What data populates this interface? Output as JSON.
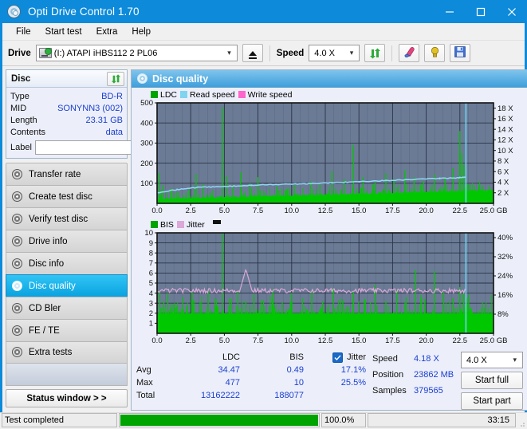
{
  "window": {
    "title": "Opti Drive Control 1.70",
    "icon": "disc-icon",
    "minimize": "minimize-icon",
    "maximize": "maximize-icon",
    "close": "close-icon",
    "accent": "#0d8ada"
  },
  "menu": {
    "items": [
      "File",
      "Start test",
      "Extra",
      "Help"
    ]
  },
  "toolbar": {
    "drive_label": "Drive",
    "drive_value": "(I:)  ATAPI iHBS112  2 PL06",
    "eject_icon": "eject-icon",
    "speed_label": "Speed",
    "speed_value": "4.0 X",
    "refresh_icon": "refresh-icon",
    "eraser_icon": "eraser-icon",
    "bulb_icon": "bulb-icon",
    "save_icon": "save-icon"
  },
  "disc": {
    "title": "Disc",
    "refresh_icon": "refresh-icon",
    "rows": [
      {
        "key": "Type",
        "value": "BD-R"
      },
      {
        "key": "MID",
        "value": "SONYNN3 (002)"
      },
      {
        "key": "Length",
        "value": "23.31 GB"
      },
      {
        "key": "Contents",
        "value": "data"
      }
    ],
    "label_key": "Label",
    "label_value": "",
    "label_placeholder": "",
    "cd_icon": "cd-icon"
  },
  "nav": {
    "items": [
      {
        "label": "Transfer rate",
        "active": false
      },
      {
        "label": "Create test disc",
        "active": false
      },
      {
        "label": "Verify test disc",
        "active": false
      },
      {
        "label": "Drive info",
        "active": false
      },
      {
        "label": "Disc info",
        "active": false
      },
      {
        "label": "Disc quality",
        "active": true
      },
      {
        "label": "CD Bler",
        "active": false
      },
      {
        "label": "FE / TE",
        "active": false
      },
      {
        "label": "Extra tests",
        "active": false
      }
    ],
    "status_button": "Status window > >"
  },
  "main": {
    "title": "Disc quality",
    "icon": "disc-quality-icon"
  },
  "chart_data": [
    {
      "type": "line",
      "name": "ldc-chart",
      "title": "",
      "xlabel": "",
      "ylabel": "",
      "legend": [
        {
          "label": "LDC",
          "color": "#00a400"
        },
        {
          "label": "Read speed",
          "color": "#7fd4f0"
        },
        {
          "label": "Write speed",
          "color": "#ff66cc"
        }
      ],
      "legend_position": "top-left",
      "grid": true,
      "plot_bg": "#6b7b96",
      "xlim": [
        0,
        25.0
      ],
      "xticks": [
        0.0,
        2.5,
        5.0,
        7.5,
        10.0,
        12.5,
        15.0,
        17.5,
        20.0,
        22.5,
        25.0
      ],
      "xticklabels": [
        "0.0",
        "2.5",
        "5.0",
        "7.5",
        "10.0",
        "12.5",
        "15.0",
        "17.5",
        "20.0",
        "22.5",
        "25.0 GB"
      ],
      "ylim": [
        0,
        500
      ],
      "yticks": [
        100,
        200,
        300,
        400,
        500
      ],
      "yticklabels": [
        "100",
        "200",
        "300",
        "400",
        "500"
      ],
      "y2lim": [
        0,
        19
      ],
      "y2ticks": [
        2,
        4,
        6,
        8,
        10,
        12,
        14,
        16,
        18
      ],
      "y2ticklabels": [
        "2 X",
        "4 X",
        "6 X",
        "8 X",
        "10 X",
        "12 X",
        "14 X",
        "16 X",
        "18 X"
      ],
      "series": [
        {
          "name": "LDC",
          "color": "#00c800",
          "style": "filled-spikes",
          "baseline": [
            18,
            20,
            22,
            19,
            24,
            21,
            26,
            23,
            20,
            25,
            22,
            27,
            24,
            21,
            26,
            23,
            28,
            25,
            22,
            27,
            24,
            29,
            26,
            23,
            28,
            25,
            30,
            27,
            24,
            29,
            26,
            31,
            28,
            25,
            30,
            27,
            32,
            29,
            26,
            31,
            28,
            33,
            30,
            27,
            32,
            29,
            34,
            31,
            28,
            33,
            30,
            35,
            32,
            29,
            34,
            31,
            36,
            33,
            30,
            35,
            32,
            37,
            34,
            31,
            36,
            33,
            38,
            35,
            32,
            37,
            34,
            39,
            36,
            33,
            38,
            35,
            40,
            37,
            34,
            39,
            36,
            41,
            38,
            35,
            40,
            37,
            42,
            39,
            36,
            41,
            38,
            43,
            40,
            37,
            42,
            39,
            44,
            41,
            38,
            43,
            40,
            45,
            42,
            39,
            44,
            41,
            46,
            43,
            40,
            45,
            42,
            47,
            44,
            41,
            46,
            43,
            48,
            45,
            42,
            47,
            44,
            49,
            46,
            43,
            48,
            45,
            50,
            47,
            44,
            49,
            46,
            51,
            48,
            45,
            50,
            47,
            52,
            49,
            46,
            51,
            48,
            53,
            50,
            47,
            52,
            49,
            54,
            51,
            48,
            53,
            50,
            55,
            52,
            49,
            54,
            51,
            56,
            53,
            50,
            55,
            52,
            57,
            54,
            51,
            56,
            53,
            58,
            55,
            52,
            57,
            54,
            59,
            56,
            53,
            58,
            55,
            60,
            57,
            54,
            59,
            56,
            61,
            58,
            55,
            60,
            57,
            62,
            59,
            56,
            61,
            58,
            63,
            60,
            57,
            62,
            59,
            64,
            61,
            58,
            63,
            62,
            66,
            63,
            60,
            65,
            62,
            67,
            64,
            61,
            66,
            63,
            68,
            65,
            62,
            67,
            64,
            69,
            66,
            63,
            68
          ],
          "spikes": [
            {
              "x": 0.15,
              "y": 150
            },
            {
              "x": 0.45,
              "y": 90
            },
            {
              "x": 1.1,
              "y": 75
            },
            {
              "x": 2.4,
              "y": 70
            },
            {
              "x": 2.9,
              "y": 145
            },
            {
              "x": 3.4,
              "y": 95
            },
            {
              "x": 4.85,
              "y": 477
            },
            {
              "x": 5.15,
              "y": 135
            },
            {
              "x": 5.6,
              "y": 90
            },
            {
              "x": 6.2,
              "y": 155
            },
            {
              "x": 6.9,
              "y": 100
            },
            {
              "x": 7.5,
              "y": 130
            },
            {
              "x": 8.9,
              "y": 85
            },
            {
              "x": 10.2,
              "y": 90
            },
            {
              "x": 11.4,
              "y": 110
            },
            {
              "x": 12.1,
              "y": 95
            },
            {
              "x": 13.0,
              "y": 160
            },
            {
              "x": 13.9,
              "y": 120
            },
            {
              "x": 14.6,
              "y": 290
            },
            {
              "x": 15.3,
              "y": 130
            },
            {
              "x": 16.2,
              "y": 105
            },
            {
              "x": 17.0,
              "y": 150
            },
            {
              "x": 17.6,
              "y": 120
            },
            {
              "x": 18.4,
              "y": 165
            },
            {
              "x": 19.1,
              "y": 130
            },
            {
              "x": 19.8,
              "y": 110
            },
            {
              "x": 20.6,
              "y": 145
            },
            {
              "x": 21.4,
              "y": 125
            },
            {
              "x": 22.0,
              "y": 175
            },
            {
              "x": 22.5,
              "y": 360
            },
            {
              "x": 22.65,
              "y": 250
            },
            {
              "x": 22.8,
              "y": 190
            }
          ]
        },
        {
          "name": "Read speed",
          "color": "#8fd8f5",
          "style": "step-line",
          "points": [
            {
              "x": 0.0,
              "y": 2.0
            },
            {
              "x": 1.5,
              "y": 2.6
            },
            {
              "x": 3.0,
              "y": 3.0
            },
            {
              "x": 5.0,
              "y": 3.2
            },
            {
              "x": 7.0,
              "y": 3.4
            },
            {
              "x": 9.0,
              "y": 3.6
            },
            {
              "x": 11.0,
              "y": 3.7
            },
            {
              "x": 13.0,
              "y": 3.9
            },
            {
              "x": 15.0,
              "y": 4.1
            },
            {
              "x": 17.0,
              "y": 4.3
            },
            {
              "x": 19.0,
              "y": 4.5
            },
            {
              "x": 21.0,
              "y": 4.7
            },
            {
              "x": 22.4,
              "y": 4.85
            },
            {
              "x": 22.9,
              "y": 5.0
            }
          ]
        }
      ],
      "markers": [
        {
          "type": "vline",
          "x": 22.95,
          "color": "#6fd3f2"
        }
      ]
    },
    {
      "type": "line",
      "name": "bis-chart",
      "title": "",
      "legend": [
        {
          "label": "BIS",
          "color": "#00a400"
        },
        {
          "label": "Jitter",
          "color": "#dba8d8"
        }
      ],
      "legend_position": "top-left",
      "grid": true,
      "plot_bg": "#6b7b96",
      "xlim": [
        0,
        25.0
      ],
      "xticks": [
        0.0,
        2.5,
        5.0,
        7.5,
        10.0,
        12.5,
        15.0,
        17.5,
        20.0,
        22.5,
        25.0
      ],
      "xticklabels": [
        "0.0",
        "2.5",
        "5.0",
        "7.5",
        "10.0",
        "12.5",
        "15.0",
        "17.5",
        "20.0",
        "22.5",
        "25.0 GB"
      ],
      "ylim": [
        0,
        10
      ],
      "yticks": [
        1,
        2,
        3,
        4,
        5,
        6,
        7,
        8,
        9,
        10
      ],
      "yticklabels": [
        "1",
        "2",
        "3",
        "4",
        "5",
        "6",
        "7",
        "8",
        "9",
        "10"
      ],
      "y2lim": [
        0,
        42
      ],
      "y2ticks": [
        8,
        16,
        24,
        32,
        40
      ],
      "y2ticklabels": [
        "8%",
        "16%",
        "24%",
        "32%",
        "40%"
      ],
      "series": [
        {
          "name": "BIS",
          "color": "#00c800",
          "style": "filled-spikes",
          "baseline_level": 2.0,
          "spikes": [
            {
              "x": 0.2,
              "y": 4.1
            },
            {
              "x": 0.5,
              "y": 3.2
            },
            {
              "x": 0.8,
              "y": 4.0
            },
            {
              "x": 1.3,
              "y": 3.0
            },
            {
              "x": 1.9,
              "y": 3.6
            },
            {
              "x": 2.6,
              "y": 4.2
            },
            {
              "x": 3.2,
              "y": 3.1
            },
            {
              "x": 3.8,
              "y": 4.3
            },
            {
              "x": 4.4,
              "y": 3.4
            },
            {
              "x": 4.85,
              "y": 10.0
            },
            {
              "x": 5.4,
              "y": 3.5
            },
            {
              "x": 6.0,
              "y": 4.2
            },
            {
              "x": 6.6,
              "y": 3.2
            },
            {
              "x": 7.2,
              "y": 3.9
            },
            {
              "x": 7.9,
              "y": 3.3
            },
            {
              "x": 8.6,
              "y": 4.4
            },
            {
              "x": 9.3,
              "y": 3.1
            },
            {
              "x": 10.0,
              "y": 4.0
            },
            {
              "x": 10.8,
              "y": 3.5
            },
            {
              "x": 11.5,
              "y": 4.2
            },
            {
              "x": 12.3,
              "y": 3.2
            },
            {
              "x": 13.1,
              "y": 4.5
            },
            {
              "x": 13.8,
              "y": 3.3
            },
            {
              "x": 14.6,
              "y": 4.1
            },
            {
              "x": 15.4,
              "y": 3.4
            },
            {
              "x": 16.2,
              "y": 4.8
            },
            {
              "x": 17.0,
              "y": 3.2
            },
            {
              "x": 17.8,
              "y": 4.3
            },
            {
              "x": 18.5,
              "y": 3.6
            },
            {
              "x": 19.2,
              "y": 6.3
            },
            {
              "x": 19.9,
              "y": 3.4
            },
            {
              "x": 20.6,
              "y": 6.2
            },
            {
              "x": 21.3,
              "y": 4.1
            },
            {
              "x": 22.0,
              "y": 3.5
            },
            {
              "x": 22.5,
              "y": 4.6
            },
            {
              "x": 22.8,
              "y": 4.0
            }
          ]
        },
        {
          "name": "Jitter",
          "color": "#dba8d8",
          "style": "noisy-line",
          "mean_pct": 17.1,
          "mean_y": 4.25,
          "noise": 0.22,
          "peaks": [
            {
              "x": 6.6,
              "y": 6.4
            }
          ]
        }
      ],
      "markers": [
        {
          "type": "vline",
          "x": 22.95,
          "color": "#6fd3f2"
        }
      ]
    }
  ],
  "stats": {
    "columns": [
      "LDC",
      "BIS"
    ],
    "jitter_label": "Jitter",
    "jitter_checked": true,
    "rows": [
      {
        "label": "Avg",
        "ldc": "34.47",
        "bis": "0.49",
        "jitter": "17.1%"
      },
      {
        "label": "Max",
        "ldc": "477",
        "bis": "10",
        "jitter": "25.5%"
      },
      {
        "label": "Total",
        "ldc": "13162222",
        "bis": "188077",
        "jitter": ""
      }
    ]
  },
  "run": {
    "speed_label": "Speed",
    "speed_value": "4.18 X",
    "speed_select": "4.0 X",
    "position_label": "Position",
    "position_value": "23862 MB",
    "samples_label": "Samples",
    "samples_value": "379565",
    "start_full": "Start full",
    "start_part": "Start part"
  },
  "statusbar": {
    "message": "Test completed",
    "progress_pct": "100.0%",
    "progress_value": 100,
    "elapsed": "33:15"
  }
}
